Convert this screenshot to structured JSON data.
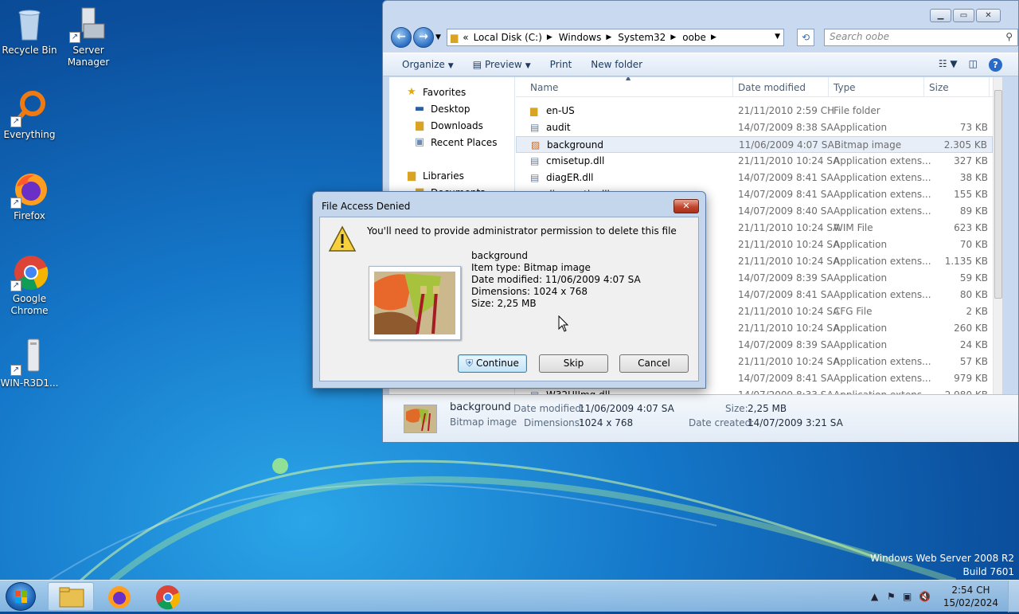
{
  "desktop": {
    "icons": [
      {
        "label": "Recycle Bin"
      },
      {
        "label": "Server\nManager"
      },
      {
        "label": "Everything"
      },
      {
        "label": "Firefox"
      },
      {
        "label": "Google\nChrome"
      },
      {
        "label": "WIN-R3D1..."
      }
    ],
    "watermark": {
      "line1": "Windows Web Server 2008 R2",
      "line2": "Build 7601"
    }
  },
  "explorer": {
    "address": {
      "crumbs": [
        "Local Disk (C:)",
        "Windows",
        "System32",
        "oobe"
      ],
      "prefix": "«"
    },
    "search_placeholder": "Search oobe",
    "commands": {
      "organize": "Organize",
      "preview": "Preview",
      "print": "Print",
      "new_folder": "New folder"
    },
    "nav": {
      "favorites": "Favorites",
      "desktop": "Desktop",
      "downloads": "Downloads",
      "recent": "Recent Places",
      "libraries": "Libraries",
      "documents": "Documents"
    },
    "columns": {
      "name": "Name",
      "date": "Date modified",
      "type": "Type",
      "size": "Size"
    },
    "files": [
      {
        "name": "en-US",
        "date": "21/11/2010 2:59 CH",
        "type": "File folder",
        "size": ""
      },
      {
        "name": "audit",
        "date": "14/07/2009 8:38 SA",
        "type": "Application",
        "size": "73 KB"
      },
      {
        "name": "background",
        "date": "11/06/2009 4:07 SA",
        "type": "Bitmap image",
        "size": "2.305 KB"
      },
      {
        "name": "cmisetup.dll",
        "date": "21/11/2010 10:24 SA",
        "type": "Application extens...",
        "size": "327 KB"
      },
      {
        "name": "diagER.dll",
        "date": "14/07/2009 8:41 SA",
        "type": "Application extens...",
        "size": "38 KB"
      },
      {
        "name": "diagnostic.dll",
        "date": "14/07/2009 8:41 SA",
        "type": "Application extens...",
        "size": "155 KB"
      },
      {
        "name": "",
        "date": "14/07/2009 8:40 SA",
        "type": "Application extens...",
        "size": "89 KB"
      },
      {
        "name": "",
        "date": "21/11/2010 10:24 SA",
        "type": "WIM File",
        "size": "623 KB"
      },
      {
        "name": "",
        "date": "21/11/2010 10:24 SA",
        "type": "Application",
        "size": "70 KB"
      },
      {
        "name": "",
        "date": "21/11/2010 10:24 SA",
        "type": "Application extens...",
        "size": "1.135 KB"
      },
      {
        "name": "",
        "date": "14/07/2009 8:39 SA",
        "type": "Application",
        "size": "59 KB"
      },
      {
        "name": "",
        "date": "14/07/2009 8:41 SA",
        "type": "Application extens...",
        "size": "80 KB"
      },
      {
        "name": "",
        "date": "21/11/2010 10:24 SA",
        "type": "CFG File",
        "size": "2 KB"
      },
      {
        "name": "",
        "date": "21/11/2010 10:24 SA",
        "type": "Application",
        "size": "260 KB"
      },
      {
        "name": "",
        "date": "14/07/2009 8:39 SA",
        "type": "Application",
        "size": "24 KB"
      },
      {
        "name": "",
        "date": "21/11/2010 10:24 SA",
        "type": "Application extens...",
        "size": "57 KB"
      },
      {
        "name": "",
        "date": "14/07/2009 8:41 SA",
        "type": "Application extens...",
        "size": "979 KB"
      },
      {
        "name": "W32UIImg.dll",
        "date": "14/07/2009 8:33 SA",
        "type": "Application extens...",
        "size": "2.980 KB"
      }
    ],
    "details": {
      "name": "background",
      "kind": "Bitmap image",
      "date_label": "Date modified:",
      "date_value": "11/06/2009 4:07 SA",
      "dims_label": "Dimensions:",
      "dims_value": "1024 x 768",
      "size_label": "Size:",
      "size_value": "2,25 MB",
      "created_label": "Date created:",
      "created_value": "14/07/2009 3:21 SA"
    }
  },
  "dialog": {
    "title": "File Access Denied",
    "message": "You'll need to provide administrator permission to delete this file",
    "file_name": "background",
    "item_type": "Item type: Bitmap image",
    "date_modified": "Date modified: 11/06/2009 4:07 SA",
    "dimensions": "Dimensions: 1024 x 768",
    "size": "Size: 2,25 MB",
    "buttons": {
      "continue": "Continue",
      "skip": "Skip",
      "cancel": "Cancel"
    }
  },
  "taskbar": {
    "time": "2:54 CH",
    "date": "15/02/2024"
  },
  "colors": {
    "accent": "#1e67b8",
    "close_red": "#c0452c",
    "selection": "#e8eef7"
  }
}
